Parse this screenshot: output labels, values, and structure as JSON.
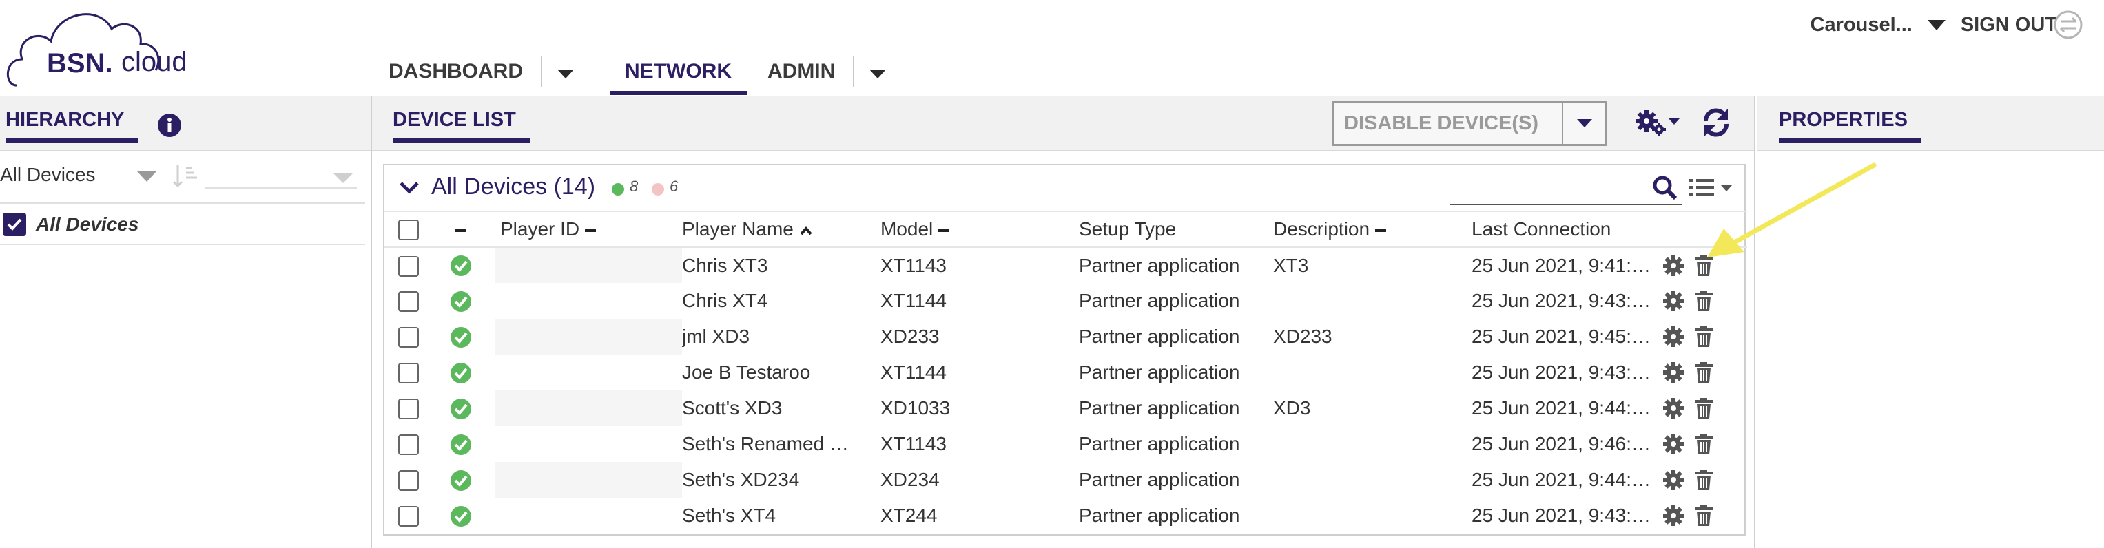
{
  "brand": {
    "logo_text_1": "BSN.",
    "logo_text_2": "cloud"
  },
  "nav": {
    "items": [
      {
        "label": "DASHBOARD",
        "active": false,
        "has_menu": true
      },
      {
        "label": "NETWORK",
        "active": true,
        "has_menu": false
      },
      {
        "label": "ADMIN",
        "active": false,
        "has_menu": true
      }
    ]
  },
  "account": {
    "name": "Carousel...",
    "sign_out": "SIGN OUT"
  },
  "hierarchy": {
    "title": "HIERARCHY",
    "filter_value": "All Devices",
    "tree_root": "All Devices"
  },
  "device_list": {
    "title": "DEVICE LIST",
    "disable_button": "DISABLE DEVICE(S)",
    "group_title": "All Devices (14)",
    "online_count": "8",
    "offline_count": "6",
    "search_placeholder": "",
    "columns": {
      "player_id": "Player ID",
      "player_name": "Player Name",
      "model": "Model",
      "setup_type": "Setup Type",
      "description": "Description",
      "last_connection": "Last Connection"
    },
    "rows": [
      {
        "player_id": "",
        "player_name": "Chris XT3",
        "model": "XT1143",
        "setup_type": "Partner application",
        "description": "XT3",
        "last_connection": "25 Jun 2021, 9:41:…"
      },
      {
        "player_id": "",
        "player_name": "Chris XT4",
        "model": "XT1144",
        "setup_type": "Partner application",
        "description": "",
        "last_connection": "25 Jun 2021, 9:43:…"
      },
      {
        "player_id": "",
        "player_name": "jml XD3",
        "model": "XD233",
        "setup_type": "Partner application",
        "description": "XD233",
        "last_connection": "25 Jun 2021, 9:45:…"
      },
      {
        "player_id": "",
        "player_name": "Joe B Testaroo",
        "model": "XT1144",
        "setup_type": "Partner application",
        "description": "",
        "last_connection": "25 Jun 2021, 9:43:…"
      },
      {
        "player_id": "",
        "player_name": "Scott's XD3",
        "model": "XD1033",
        "setup_type": "Partner application",
        "description": "XD3",
        "last_connection": "25 Jun 2021, 9:44:…"
      },
      {
        "player_id": "",
        "player_name": "Seth's Renamed …",
        "model": "XT1143",
        "setup_type": "Partner application",
        "description": "",
        "last_connection": "25 Jun 2021, 9:46:…"
      },
      {
        "player_id": "",
        "player_name": "Seth's XD234",
        "model": "XD234",
        "setup_type": "Partner application",
        "description": "",
        "last_connection": "25 Jun 2021, 9:44:…"
      },
      {
        "player_id": "",
        "player_name": "Seth's XT4",
        "model": "XT244",
        "setup_type": "Partner application",
        "description": "",
        "last_connection": "25 Jun 2021, 9:43:…"
      }
    ]
  },
  "properties": {
    "title": "PROPERTIES"
  },
  "colors": {
    "brand": "#2c1e63",
    "online": "#5cb85c",
    "offline": "#f4b8b8",
    "annotation_arrow": "#f2e85a"
  },
  "icons": [
    "info-icon",
    "sort-icon",
    "gears-icon",
    "refresh-icon",
    "search-icon",
    "list-view-icon",
    "status-check-icon",
    "gear-icon",
    "trash-icon",
    "sync-icon"
  ]
}
